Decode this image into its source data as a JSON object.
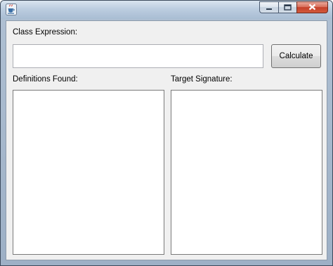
{
  "window": {
    "icon": "java-cup-icon",
    "controls": {
      "minimize_icon": "minimize-icon",
      "maximize_icon": "maximize-icon",
      "close_icon": "close-icon"
    }
  },
  "form": {
    "class_expression_label": "Class Expression:",
    "class_expression_value": "",
    "calculate_label": "Calculate",
    "definitions_label": "Definitions Found:",
    "target_signature_label": "Target Signature:",
    "definitions_items": [],
    "target_signature_items": []
  },
  "colors": {
    "close_button": "#c4402a",
    "panel_background": "#f0f0f0"
  }
}
